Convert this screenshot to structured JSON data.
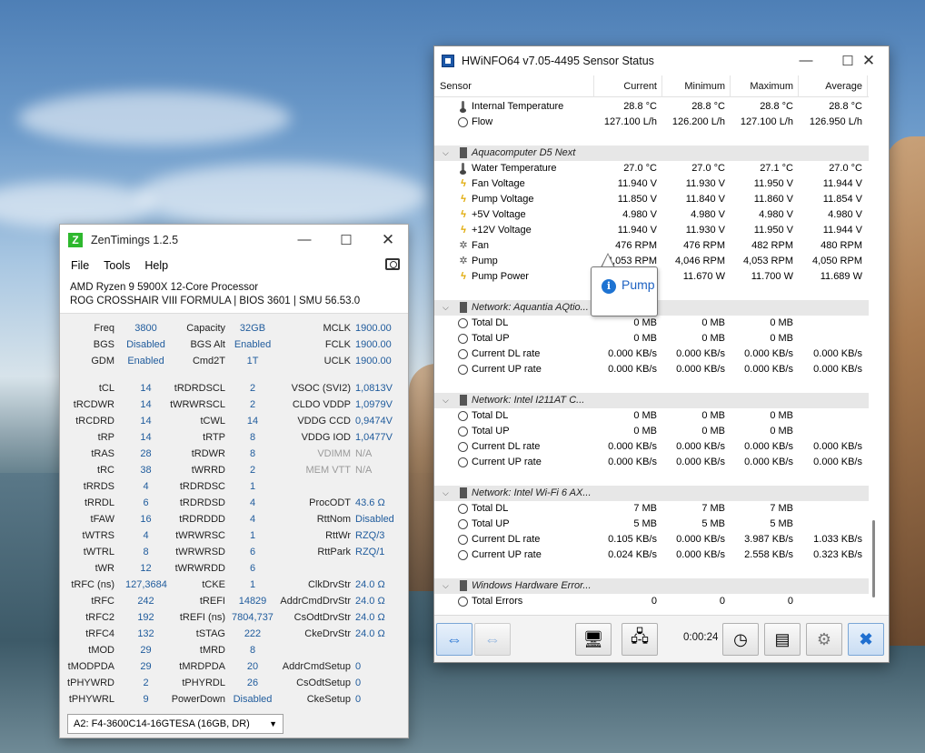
{
  "zentimings": {
    "title": "ZenTimings 1.2.5",
    "logo": "Z",
    "menu": [
      "File",
      "Tools",
      "Help"
    ],
    "cpu": "AMD Ryzen 9 5900X 12-Core Processor",
    "board": "ROG CROSSHAIR VIII FORMULA | BIOS 3601 | SMU 56.53.0",
    "top": [
      {
        "l1": "Freq",
        "v1": "3800",
        "l2": "Capacity",
        "v2": "32GB",
        "l3": "MCLK",
        "v3": "1900.00"
      },
      {
        "l1": "BGS",
        "v1": "Disabled",
        "l2": "BGS Alt",
        "v2": "Enabled",
        "l3": "FCLK",
        "v3": "1900.00"
      },
      {
        "l1": "GDM",
        "v1": "Enabled",
        "l2": "Cmd2T",
        "v2": "1T",
        "l3": "UCLK",
        "v3": "1900.00"
      }
    ],
    "timings": [
      {
        "l1": "tCL",
        "v1": "14",
        "l2": "tRDRDSCL",
        "v2": "2",
        "l3": "VSOC (SVI2)",
        "v3": "1,0813V"
      },
      {
        "l1": "tRCDWR",
        "v1": "14",
        "l2": "tWRWRSCL",
        "v2": "2",
        "l3": "CLDO VDDP",
        "v3": "1,0979V"
      },
      {
        "l1": "tRCDRD",
        "v1": "14",
        "l2": "tCWL",
        "v2": "14",
        "l3": "VDDG CCD",
        "v3": "0,9474V"
      },
      {
        "l1": "tRP",
        "v1": "14",
        "l2": "tRTP",
        "v2": "8",
        "l3": "VDDG IOD",
        "v3": "1,0477V"
      },
      {
        "l1": "tRAS",
        "v1": "28",
        "l2": "tRDWR",
        "v2": "8",
        "l3": "VDIMM",
        "v3": "N/A"
      },
      {
        "l1": "tRC",
        "v1": "38",
        "l2": "tWRRD",
        "v2": "2",
        "l3": "MEM VTT",
        "v3": "N/A"
      },
      {
        "l1": "tRRDS",
        "v1": "4",
        "l2": "tRDRDSC",
        "v2": "1",
        "l3": "",
        "v3": ""
      },
      {
        "l1": "tRRDL",
        "v1": "6",
        "l2": "tRDRDSD",
        "v2": "4",
        "l3": "ProcODT",
        "v3": "43.6 Ω"
      },
      {
        "l1": "tFAW",
        "v1": "16",
        "l2": "tRDRDDD",
        "v2": "4",
        "l3": "RttNom",
        "v3": "Disabled"
      },
      {
        "l1": "tWTRS",
        "v1": "4",
        "l2": "tWRWRSC",
        "v2": "1",
        "l3": "RttWr",
        "v3": "RZQ/3"
      },
      {
        "l1": "tWTRL",
        "v1": "8",
        "l2": "tWRWRSD",
        "v2": "6",
        "l3": "RttPark",
        "v3": "RZQ/1"
      },
      {
        "l1": "tWR",
        "v1": "12",
        "l2": "tWRWRDD",
        "v2": "6",
        "l3": "",
        "v3": ""
      },
      {
        "l1": "tRFC (ns)",
        "v1": "127,3684",
        "l2": "tCKE",
        "v2": "1",
        "l3": "ClkDrvStr",
        "v3": "24.0 Ω"
      },
      {
        "l1": "tRFC",
        "v1": "242",
        "l2": "tREFI",
        "v2": "14829",
        "l3": "AddrCmdDrvStr",
        "v3": "24.0 Ω"
      },
      {
        "l1": "tRFC2",
        "v1": "192",
        "l2": "tREFI (ns)",
        "v2": "7804,737",
        "l3": "CsOdtDrvStr",
        "v3": "24.0 Ω"
      },
      {
        "l1": "tRFC4",
        "v1": "132",
        "l2": "tSTAG",
        "v2": "222",
        "l3": "CkeDrvStr",
        "v3": "24.0 Ω"
      },
      {
        "l1": "tMOD",
        "v1": "29",
        "l2": "tMRD",
        "v2": "8",
        "l3": "",
        "v3": ""
      },
      {
        "l1": "tMODPDA",
        "v1": "29",
        "l2": "tMRDPDA",
        "v2": "20",
        "l3": "AddrCmdSetup",
        "v3": "0"
      },
      {
        "l1": "tPHYWRD",
        "v1": "2",
        "l2": "tPHYRDL",
        "v2": "26",
        "l3": "CsOdtSetup",
        "v3": "0"
      },
      {
        "l1": "tPHYWRL",
        "v1": "9",
        "l2": "PowerDown",
        "v2": "Disabled",
        "l3": "CkeSetup",
        "v3": "0"
      }
    ],
    "module": "A2: F4-3600C14-16GTESA (16GB, DR)"
  },
  "hwinfo": {
    "title": "HWiNFO64 v7.05-4495 Sensor Status",
    "columns": [
      "Sensor",
      "Current",
      "Minimum",
      "Maximum",
      "Average"
    ],
    "rows": [
      {
        "type": "item",
        "icon": "therm",
        "name": "Internal Temperature",
        "cur": "28.8 °C",
        "min": "28.8 °C",
        "max": "28.8 °C",
        "avg": "28.8 °C"
      },
      {
        "type": "item",
        "icon": "clock",
        "name": "Flow",
        "cur": "127.100 L/h",
        "min": "126.200 L/h",
        "max": "127.100 L/h",
        "avg": "126.950 L/h"
      },
      {
        "type": "blank"
      },
      {
        "type": "group",
        "name": "Aquacomputer D5 Next"
      },
      {
        "type": "item",
        "icon": "therm",
        "name": "Water Temperature",
        "cur": "27.0 °C",
        "min": "27.0 °C",
        "max": "27.1 °C",
        "avg": "27.0 °C"
      },
      {
        "type": "item",
        "icon": "bolt",
        "name": "Fan Voltage",
        "cur": "11.940 V",
        "min": "11.930 V",
        "max": "11.950 V",
        "avg": "11.944 V"
      },
      {
        "type": "item",
        "icon": "bolt",
        "name": "Pump Voltage",
        "cur": "11.850 V",
        "min": "11.840 V",
        "max": "11.860 V",
        "avg": "11.854 V"
      },
      {
        "type": "item",
        "icon": "bolt",
        "name": "+5V Voltage",
        "cur": "4.980 V",
        "min": "4.980 V",
        "max": "4.980 V",
        "avg": "4.980 V"
      },
      {
        "type": "item",
        "icon": "bolt",
        "name": "+12V Voltage",
        "cur": "11.940 V",
        "min": "11.930 V",
        "max": "11.950 V",
        "avg": "11.944 V"
      },
      {
        "type": "item",
        "icon": "fan",
        "name": "Fan",
        "cur": "476 RPM",
        "min": "476 RPM",
        "max": "482 RPM",
        "avg": "480 RPM"
      },
      {
        "type": "item",
        "icon": "fan",
        "name": "Pump",
        "cur": "4,053 RPM",
        "min": "4,046 RPM",
        "max": "4,053 RPM",
        "avg": "4,050 RPM"
      },
      {
        "type": "item",
        "icon": "bolt",
        "name": "Pump Power",
        "cur": "",
        "min": "11.670 W",
        "max": "11.700 W",
        "avg": "11.689 W"
      },
      {
        "type": "blank"
      },
      {
        "type": "group",
        "name": "Network: Aquantia AQtio..."
      },
      {
        "type": "item",
        "icon": "clock",
        "name": "Total DL",
        "cur": "0 MB",
        "min": "0 MB",
        "max": "0 MB",
        "avg": ""
      },
      {
        "type": "item",
        "icon": "clock",
        "name": "Total UP",
        "cur": "0 MB",
        "min": "0 MB",
        "max": "0 MB",
        "avg": ""
      },
      {
        "type": "item",
        "icon": "clock",
        "name": "Current DL rate",
        "cur": "0.000 KB/s",
        "min": "0.000 KB/s",
        "max": "0.000 KB/s",
        "avg": "0.000 KB/s"
      },
      {
        "type": "item",
        "icon": "clock",
        "name": "Current UP rate",
        "cur": "0.000 KB/s",
        "min": "0.000 KB/s",
        "max": "0.000 KB/s",
        "avg": "0.000 KB/s"
      },
      {
        "type": "blank"
      },
      {
        "type": "group",
        "name": "Network: Intel I211AT C..."
      },
      {
        "type": "item",
        "icon": "clock",
        "name": "Total DL",
        "cur": "0 MB",
        "min": "0 MB",
        "max": "0 MB",
        "avg": ""
      },
      {
        "type": "item",
        "icon": "clock",
        "name": "Total UP",
        "cur": "0 MB",
        "min": "0 MB",
        "max": "0 MB",
        "avg": ""
      },
      {
        "type": "item",
        "icon": "clock",
        "name": "Current DL rate",
        "cur": "0.000 KB/s",
        "min": "0.000 KB/s",
        "max": "0.000 KB/s",
        "avg": "0.000 KB/s"
      },
      {
        "type": "item",
        "icon": "clock",
        "name": "Current UP rate",
        "cur": "0.000 KB/s",
        "min": "0.000 KB/s",
        "max": "0.000 KB/s",
        "avg": "0.000 KB/s"
      },
      {
        "type": "blank"
      },
      {
        "type": "group",
        "name": "Network: Intel Wi-Fi 6 AX..."
      },
      {
        "type": "item",
        "icon": "clock",
        "name": "Total DL",
        "cur": "7 MB",
        "min": "7 MB",
        "max": "7 MB",
        "avg": ""
      },
      {
        "type": "item",
        "icon": "clock",
        "name": "Total UP",
        "cur": "5 MB",
        "min": "5 MB",
        "max": "5 MB",
        "avg": ""
      },
      {
        "type": "item",
        "icon": "clock",
        "name": "Current DL rate",
        "cur": "0.105 KB/s",
        "min": "0.000 KB/s",
        "max": "3.987 KB/s",
        "avg": "1.033 KB/s"
      },
      {
        "type": "item",
        "icon": "clock",
        "name": "Current UP rate",
        "cur": "0.024 KB/s",
        "min": "0.000 KB/s",
        "max": "2.558 KB/s",
        "avg": "0.323 KB/s"
      },
      {
        "type": "blank"
      },
      {
        "type": "group",
        "name": "Windows Hardware Error..."
      },
      {
        "type": "item",
        "icon": "clock",
        "name": "Total Errors",
        "cur": "0",
        "min": "0",
        "max": "0",
        "avg": ""
      }
    ],
    "tooltip": "Pump",
    "timer": "0:00:24"
  }
}
